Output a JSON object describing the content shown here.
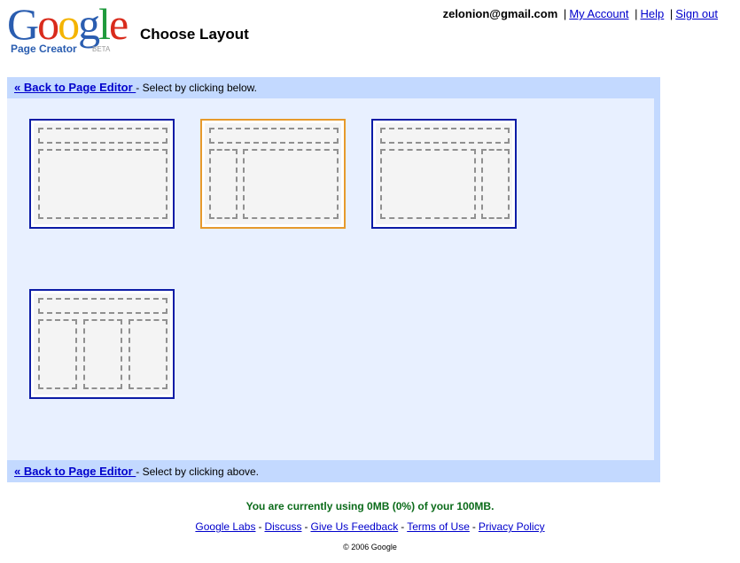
{
  "header": {
    "logo_letters": [
      "G",
      "o",
      "o",
      "g",
      "l",
      "e"
    ],
    "logo_colors": [
      "#2a5db0",
      "#d92b1c",
      "#f4b400",
      "#2a5db0",
      "#1e9a3c",
      "#d92b1c"
    ],
    "logo_subtitle": "Page Creator",
    "logo_badge": "BETA",
    "page_title": "Choose Layout"
  },
  "user_bar": {
    "email": "zelonion@gmail.com",
    "my_account": "My Account",
    "help": "Help",
    "sign_out": "Sign out",
    "separator": "|"
  },
  "panel": {
    "top_link": "« Back to Page Editor ",
    "top_text": "- Select by clicking below.",
    "bottom_link": "« Back to Page Editor ",
    "bottom_text": "- Select by clicking above.",
    "border_color": "#c3d9ff",
    "background": "#e8f0ff"
  },
  "layouts": [
    {
      "name": "Header, one column",
      "selected": false
    },
    {
      "name": "Header, left sidebar",
      "selected": true
    },
    {
      "name": "Header, right sidebar",
      "selected": false
    },
    {
      "name": "Header, three columns",
      "selected": false
    }
  ],
  "colors": {
    "tile_border": "#0d1ca6",
    "tile_selected_border": "#e69a2c",
    "usage_text": "#0b6b1a"
  },
  "footer": {
    "usage": "You are currently using 0MB (0%) of your 100MB.",
    "links": [
      "Google Labs",
      "Discuss",
      "Give Us Feedback",
      "Terms of Use",
      "Privacy Policy"
    ],
    "separator": "-",
    "copyright": "© 2006 Google"
  }
}
